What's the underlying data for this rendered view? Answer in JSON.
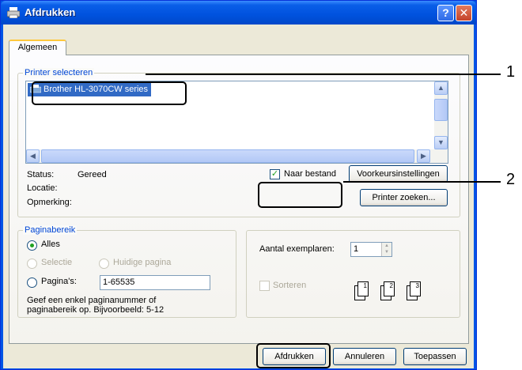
{
  "window": {
    "title": "Afdrukken",
    "help_label": "?",
    "close_label": "✕"
  },
  "tabs": [
    {
      "label": "Algemeen"
    }
  ],
  "printer_select": {
    "legend": "Printer selecteren",
    "selected_printer": "Brother HL-3070CW series",
    "status_label": "Status:",
    "status_value": "Gereed",
    "location_label": "Locatie:",
    "comment_label": "Opmerking:",
    "print_to_file_label": "Naar bestand",
    "print_to_file_checked": true,
    "preferences_button": "Voorkeursinstellingen",
    "find_printer_button": "Printer zoeken..."
  },
  "page_range": {
    "legend": "Paginabereik",
    "all_label": "Alles",
    "selection_label": "Selectie",
    "current_page_label": "Huidige pagina",
    "pages_label": "Pagina's:",
    "pages_value": "1-65535",
    "hint": "Geef een enkel paginanummer of paginabereik op. Bijvoorbeeld: 5-12",
    "selected": "all"
  },
  "copies": {
    "count_label": "Aantal exemplaren:",
    "count_value": "1",
    "collate_label": "Sorteren",
    "collate_checked": false
  },
  "footer": {
    "print_button": "Afdrukken",
    "cancel_button": "Annuleren",
    "apply_button": "Toepassen"
  },
  "callouts": [
    "1",
    "2"
  ],
  "colors": {
    "titlebar": "#0052de",
    "selection": "#316ac5",
    "group_legend": "#0046d5",
    "dialog_bg": "#ece9d8"
  }
}
